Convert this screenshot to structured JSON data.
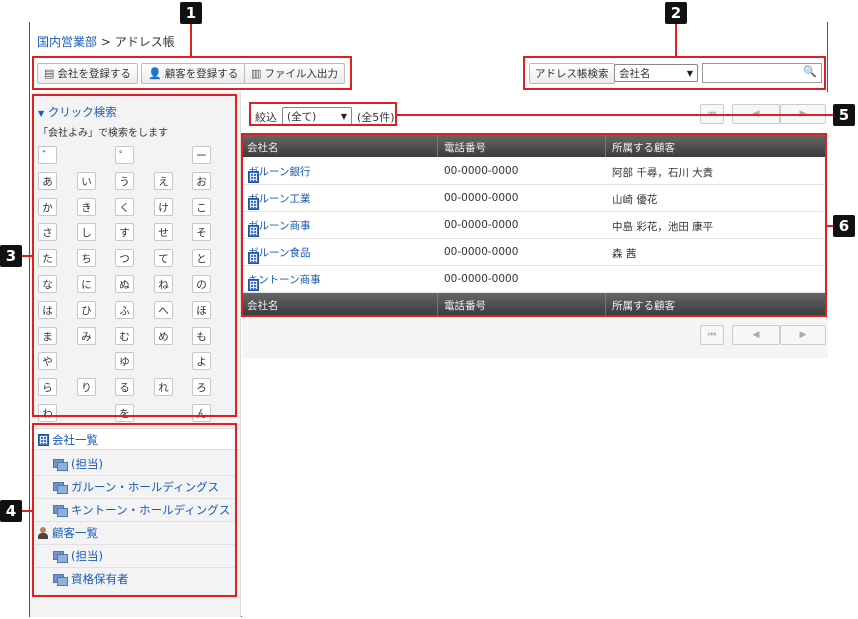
{
  "breadcrumb": {
    "parent": "国内営業部",
    "separator": ">",
    "current": "アドレス帳"
  },
  "toolbar": {
    "register_company": "会社を登録する",
    "register_customer": "顧客を登録する",
    "file_io": "ファイル入出力"
  },
  "search": {
    "button_label": "アドレス帳検索",
    "field_select": "会社名",
    "input_value": ""
  },
  "quick_search": {
    "title": "クリック検索",
    "description": "「会社よみ」で検索をします",
    "kana_rows": [
      [
        "゛",
        "",
        "゜",
        "",
        "ー"
      ],
      [
        "あ",
        "い",
        "う",
        "え",
        "お"
      ],
      [
        "か",
        "き",
        "く",
        "け",
        "こ"
      ],
      [
        "さ",
        "し",
        "す",
        "せ",
        "そ"
      ],
      [
        "た",
        "ち",
        "つ",
        "て",
        "と"
      ],
      [
        "な",
        "に",
        "ぬ",
        "ね",
        "の"
      ],
      [
        "は",
        "ひ",
        "ふ",
        "へ",
        "ほ"
      ],
      [
        "ま",
        "み",
        "む",
        "め",
        "も"
      ],
      [
        "や",
        "",
        "ゆ",
        "",
        "よ"
      ],
      [
        "ら",
        "り",
        "る",
        "れ",
        "ろ"
      ],
      [
        "わ",
        "",
        "を",
        "",
        "ん"
      ]
    ]
  },
  "tree": {
    "companies_label": "会社一覧",
    "company_groups": [
      "(担当)",
      "ガルーン・ホールディングス",
      "キントーン・ホールディングス"
    ],
    "customers_label": "顧客一覧",
    "customer_groups": [
      "(担当)",
      "資格保有者"
    ]
  },
  "filter": {
    "label": "絞込",
    "selected": "(全て)",
    "count": "(全5件)"
  },
  "table": {
    "headers": [
      "会社名",
      "電話番号",
      "所属する顧客"
    ],
    "rows": [
      {
        "company": "ガルーン銀行",
        "phone": "00-0000-0000",
        "customers": "阿部 千尋，石川 大貴"
      },
      {
        "company": "ガルーン工業",
        "phone": "00-0000-0000",
        "customers": "山崎 優花"
      },
      {
        "company": "ガルーン商事",
        "phone": "00-0000-0000",
        "customers": "中島 彩花，池田 康平"
      },
      {
        "company": "ガルーン食品",
        "phone": "00-0000-0000",
        "customers": "森 茜"
      },
      {
        "company": "キントーン商事",
        "phone": "00-0000-0000",
        "customers": ""
      }
    ]
  },
  "pager": {
    "first": "⏮",
    "prev": "◀",
    "next": "▶"
  },
  "annotations": [
    "1",
    "2",
    "3",
    "4",
    "5",
    "6"
  ],
  "colors": {
    "link": "#1a5bb5",
    "annotation": "#e02020",
    "header_bg": "#4a4a4a"
  }
}
